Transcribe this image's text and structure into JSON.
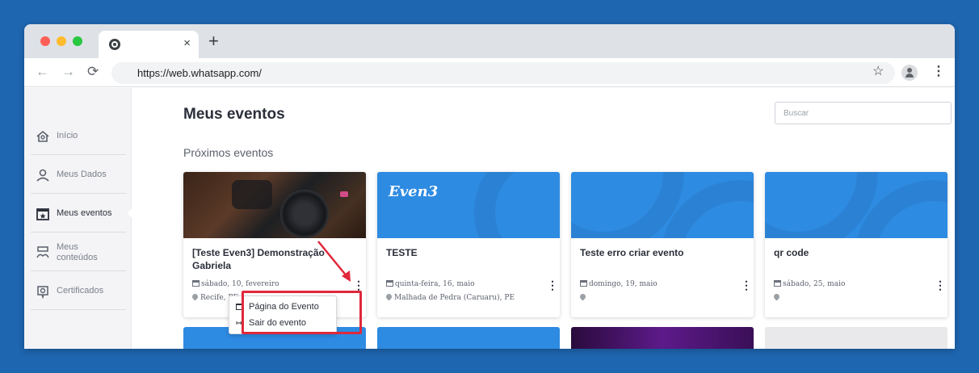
{
  "browser": {
    "tab_close": "×",
    "new_tab": "+",
    "url": "https://web.whatsapp.com/",
    "icons": [
      "chrome-icon",
      "back-icon",
      "forward-icon",
      "reload-icon",
      "star-icon",
      "profile-icon",
      "kebab-menu-icon"
    ]
  },
  "sidebar": {
    "items": [
      {
        "label": "Início",
        "icon": "home-icon"
      },
      {
        "label": "Meus Dados",
        "icon": "user-icon"
      },
      {
        "label": "Meus eventos",
        "icon": "calendar-icon",
        "active": true
      },
      {
        "label": "Meus conteúdos",
        "icon": "books-icon"
      },
      {
        "label": "Certificados",
        "icon": "certificate-icon"
      }
    ]
  },
  "main": {
    "title": "Meus eventos",
    "search_placeholder": "Buscar",
    "section_title": "Próximos eventos",
    "events": [
      {
        "title": "[Teste Even3] Demonstração Gabriela",
        "date": "sábado, 10, fevereiro",
        "location": "Recife, PE",
        "image": "photo"
      },
      {
        "title": "TESTE",
        "date": "quinta-feira, 16, maio",
        "location": "Malhada de Pedra (Caruaru), PE",
        "image": "brand",
        "brand": "Even3"
      },
      {
        "title": "Teste erro criar evento",
        "date": "domingo, 19, maio",
        "location": "",
        "image": "blue"
      },
      {
        "title": "qr code",
        "date": "sábado, 25, maio",
        "location": "",
        "image": "blue"
      }
    ],
    "menu": {
      "items": [
        {
          "label": "Página do Evento",
          "icon": "window-icon"
        },
        {
          "label": "Sair do evento",
          "icon": "exit-icon"
        }
      ]
    }
  },
  "colors": {
    "background": "#1e66b0",
    "card_blue": "#2e8be2",
    "highlight": "#e0283c"
  }
}
